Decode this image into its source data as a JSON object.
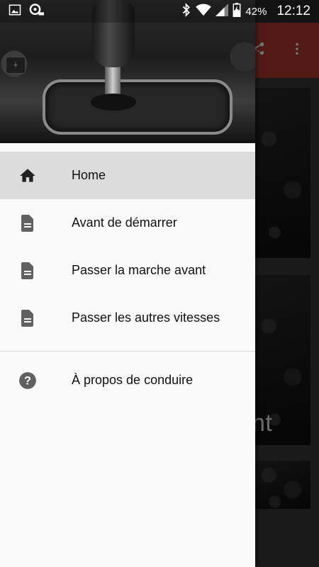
{
  "status_bar": {
    "battery_percent": "42%",
    "time": "12:12",
    "icons": [
      "image-icon",
      "sync-icon",
      "bluetooth-icon",
      "wifi-icon",
      "cell-signal-icon",
      "battery-icon"
    ]
  },
  "background_app": {
    "toolbar_color": "#b33a2e",
    "actions": [
      "share-icon",
      "overflow-menu-icon"
    ],
    "card_partial_text": "nt"
  },
  "drawer": {
    "header_image": "gear-shift-console-image",
    "items": [
      {
        "label": "Home",
        "icon": "home-icon",
        "active": true
      },
      {
        "label": "Avant de démarrer",
        "icon": "document-icon",
        "active": false
      },
      {
        "label": "Passer la marche avant",
        "icon": "document-icon",
        "active": false
      },
      {
        "label": "Passer les autres vitesses",
        "icon": "document-icon",
        "active": false
      }
    ],
    "secondary_items": [
      {
        "label": "À propos de conduire",
        "icon": "help-circle-icon"
      }
    ]
  },
  "colors": {
    "active_item_bg": "#dcdcdc",
    "drawer_bg": "#fafafa",
    "icon_color": "#616161"
  }
}
